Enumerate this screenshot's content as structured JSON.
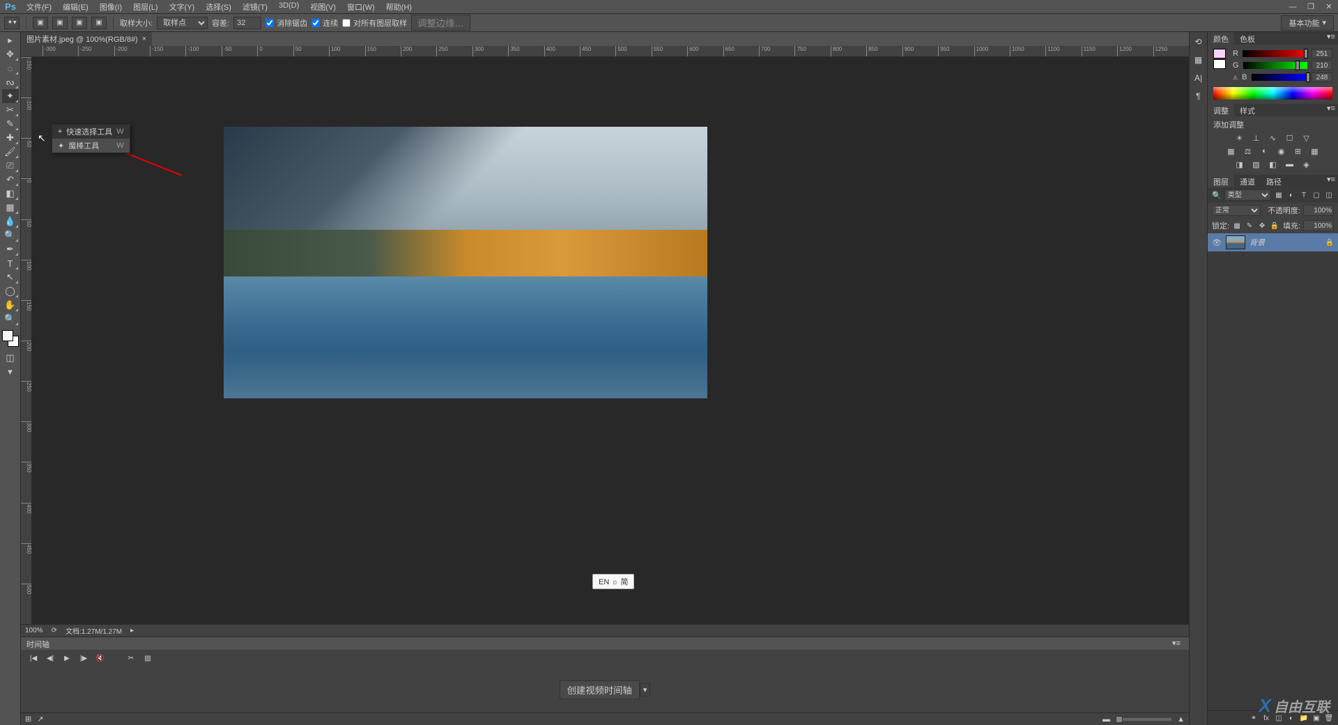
{
  "app": {
    "logo": "Ps"
  },
  "menu": {
    "file": "文件(F)",
    "edit": "编辑(E)",
    "image": "图像(I)",
    "layer": "图层(L)",
    "type": "文字(Y)",
    "select": "选择(S)",
    "filter": "滤镜(T)",
    "threeD": "3D(D)",
    "view": "视图(V)",
    "window": "窗口(W)",
    "help": "帮助(H)"
  },
  "options": {
    "sample_label": "取样大小:",
    "sample_value": "取样点",
    "tolerance_label": "容差:",
    "tolerance_value": "32",
    "antialias": "消除锯齿",
    "contiguous": "连续",
    "all_layers": "对所有图层取样",
    "refine_edge": "调整边缘…",
    "workspace": "基本功能"
  },
  "doc": {
    "tab": "图片素材.jpeg @ 100%(RGB/8#)",
    "close": "×"
  },
  "flyout": {
    "quick_select": "快速选择工具",
    "magic_wand": "魔棒工具",
    "shortcut": "W"
  },
  "status": {
    "zoom": "100%",
    "docinfo": "文档:1.27M/1.27M"
  },
  "timeline": {
    "title": "时间轴",
    "create_btn": "创建视频时间轴"
  },
  "ime": "EN ☼ 简",
  "color_panel": {
    "tab_color": "颜色",
    "tab_swatch": "色板",
    "r_label": "R",
    "r_val": "251",
    "g_label": "G",
    "g_val": "210",
    "b_label": "B",
    "b_val": "248"
  },
  "adjust_panel": {
    "tab_adjust": "调整",
    "tab_style": "样式",
    "add_label": "添加调整"
  },
  "layers_panel": {
    "tab_layers": "图层",
    "tab_channels": "通道",
    "tab_paths": "路径",
    "kind": "类型",
    "blend": "正常",
    "opacity_label": "不透明度:",
    "opacity_val": "100%",
    "lock_label": "锁定:",
    "fill_label": "填充:",
    "fill_val": "100%",
    "bg_layer": "背景"
  },
  "watermark": "自由互联"
}
